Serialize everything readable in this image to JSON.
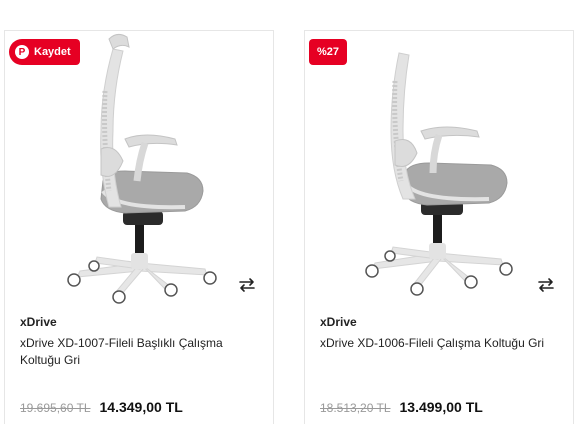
{
  "products": [
    {
      "badge": "Kaydet",
      "brand": "xDrive",
      "title": "xDrive XD-1007-Fileli Başlıklı Çalışma Koltuğu Gri",
      "old_price": "19.695,60 TL",
      "new_price": "14.349,00 TL",
      "image_icon": "office-chair-with-headrest",
      "compare_icon": "swap-arrows-icon"
    },
    {
      "badge": "%27",
      "brand": "xDrive",
      "title": "xDrive XD-1006-Fileli Çalışma Koltuğu Gri",
      "old_price": "18.513,20 TL",
      "new_price": "13.499,00 TL",
      "image_icon": "office-chair",
      "compare_icon": "swap-arrows-icon"
    }
  ],
  "colors": {
    "badge_red": "#e60023",
    "chair_frame": "#e3e3e3",
    "chair_seat": "#a9a9a9",
    "chair_black": "#1c1c1c"
  }
}
